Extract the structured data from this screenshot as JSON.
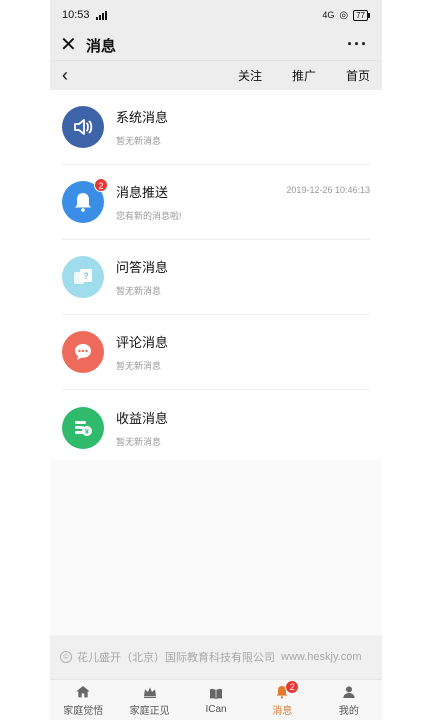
{
  "status_bar": {
    "time": "10:53",
    "network": "4G",
    "battery": "77"
  },
  "title_bar": {
    "title": "消息",
    "more_label": "···"
  },
  "nav": {
    "back_label": "‹",
    "links": [
      "关注",
      "推广",
      "首页"
    ]
  },
  "messages": [
    {
      "title": "系统消息",
      "subtitle": "暂无新消息",
      "time": "",
      "badge": "",
      "icon": "speaker-icon",
      "color": "#3d63a8"
    },
    {
      "title": "消息推送",
      "subtitle": "您有新的消息啦!",
      "time": "2019-12-26 10:46:13",
      "badge": "2",
      "icon": "bell-icon",
      "color": "#3a8ee6"
    },
    {
      "title": "问答消息",
      "subtitle": "暂无新消息",
      "time": "",
      "badge": "",
      "icon": "question-icon",
      "color": "#9fdcec"
    },
    {
      "title": "评论消息",
      "subtitle": "暂无新消息",
      "time": "",
      "badge": "",
      "icon": "comment-icon",
      "color": "#ee6a5b"
    },
    {
      "title": "收益消息",
      "subtitle": "暂无新消息",
      "time": "",
      "badge": "",
      "icon": "coins-icon",
      "color": "#2fba6c"
    }
  ],
  "footer": {
    "company": "花儿盛开（北京）国际教育科技有限公司",
    "site": "www.heskjy.com"
  },
  "tabs": [
    {
      "label": "家庭觉悟",
      "icon": "home-icon",
      "active": false,
      "badge": ""
    },
    {
      "label": "家庭正见",
      "icon": "crown-icon",
      "active": false,
      "badge": ""
    },
    {
      "label": "ICan",
      "icon": "book-icon",
      "active": false,
      "badge": ""
    },
    {
      "label": "消息",
      "icon": "bell-icon",
      "active": true,
      "badge": "2"
    },
    {
      "label": "我的",
      "icon": "user-icon",
      "active": false,
      "badge": ""
    }
  ],
  "colors": {
    "accent": "#e07b2e",
    "badge": "#e53935"
  }
}
